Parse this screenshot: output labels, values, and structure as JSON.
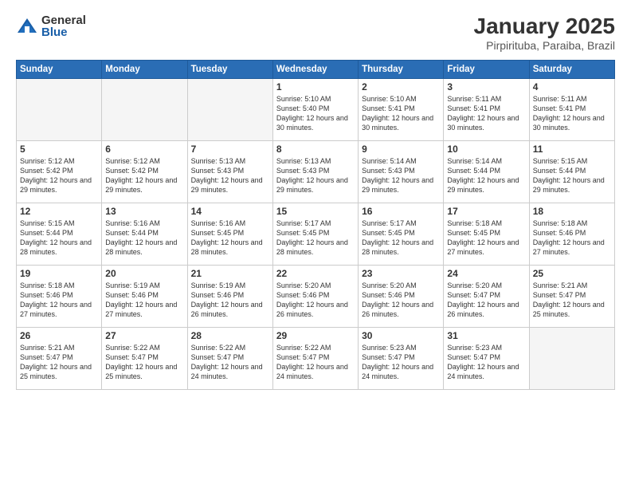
{
  "logo": {
    "general": "General",
    "blue": "Blue"
  },
  "title": "January 2025",
  "subtitle": "Pirpirituba, Paraiba, Brazil",
  "weekdays": [
    "Sunday",
    "Monday",
    "Tuesday",
    "Wednesday",
    "Thursday",
    "Friday",
    "Saturday"
  ],
  "weeks": [
    [
      {
        "day": "",
        "info": ""
      },
      {
        "day": "",
        "info": ""
      },
      {
        "day": "",
        "info": ""
      },
      {
        "day": "1",
        "info": "Sunrise: 5:10 AM\nSunset: 5:40 PM\nDaylight: 12 hours\nand 30 minutes."
      },
      {
        "day": "2",
        "info": "Sunrise: 5:10 AM\nSunset: 5:41 PM\nDaylight: 12 hours\nand 30 minutes."
      },
      {
        "day": "3",
        "info": "Sunrise: 5:11 AM\nSunset: 5:41 PM\nDaylight: 12 hours\nand 30 minutes."
      },
      {
        "day": "4",
        "info": "Sunrise: 5:11 AM\nSunset: 5:41 PM\nDaylight: 12 hours\nand 30 minutes."
      }
    ],
    [
      {
        "day": "5",
        "info": "Sunrise: 5:12 AM\nSunset: 5:42 PM\nDaylight: 12 hours\nand 29 minutes."
      },
      {
        "day": "6",
        "info": "Sunrise: 5:12 AM\nSunset: 5:42 PM\nDaylight: 12 hours\nand 29 minutes."
      },
      {
        "day": "7",
        "info": "Sunrise: 5:13 AM\nSunset: 5:43 PM\nDaylight: 12 hours\nand 29 minutes."
      },
      {
        "day": "8",
        "info": "Sunrise: 5:13 AM\nSunset: 5:43 PM\nDaylight: 12 hours\nand 29 minutes."
      },
      {
        "day": "9",
        "info": "Sunrise: 5:14 AM\nSunset: 5:43 PM\nDaylight: 12 hours\nand 29 minutes."
      },
      {
        "day": "10",
        "info": "Sunrise: 5:14 AM\nSunset: 5:44 PM\nDaylight: 12 hours\nand 29 minutes."
      },
      {
        "day": "11",
        "info": "Sunrise: 5:15 AM\nSunset: 5:44 PM\nDaylight: 12 hours\nand 29 minutes."
      }
    ],
    [
      {
        "day": "12",
        "info": "Sunrise: 5:15 AM\nSunset: 5:44 PM\nDaylight: 12 hours\nand 28 minutes."
      },
      {
        "day": "13",
        "info": "Sunrise: 5:16 AM\nSunset: 5:44 PM\nDaylight: 12 hours\nand 28 minutes."
      },
      {
        "day": "14",
        "info": "Sunrise: 5:16 AM\nSunset: 5:45 PM\nDaylight: 12 hours\nand 28 minutes."
      },
      {
        "day": "15",
        "info": "Sunrise: 5:17 AM\nSunset: 5:45 PM\nDaylight: 12 hours\nand 28 minutes."
      },
      {
        "day": "16",
        "info": "Sunrise: 5:17 AM\nSunset: 5:45 PM\nDaylight: 12 hours\nand 28 minutes."
      },
      {
        "day": "17",
        "info": "Sunrise: 5:18 AM\nSunset: 5:45 PM\nDaylight: 12 hours\nand 27 minutes."
      },
      {
        "day": "18",
        "info": "Sunrise: 5:18 AM\nSunset: 5:46 PM\nDaylight: 12 hours\nand 27 minutes."
      }
    ],
    [
      {
        "day": "19",
        "info": "Sunrise: 5:18 AM\nSunset: 5:46 PM\nDaylight: 12 hours\nand 27 minutes."
      },
      {
        "day": "20",
        "info": "Sunrise: 5:19 AM\nSunset: 5:46 PM\nDaylight: 12 hours\nand 27 minutes."
      },
      {
        "day": "21",
        "info": "Sunrise: 5:19 AM\nSunset: 5:46 PM\nDaylight: 12 hours\nand 26 minutes."
      },
      {
        "day": "22",
        "info": "Sunrise: 5:20 AM\nSunset: 5:46 PM\nDaylight: 12 hours\nand 26 minutes."
      },
      {
        "day": "23",
        "info": "Sunrise: 5:20 AM\nSunset: 5:46 PM\nDaylight: 12 hours\nand 26 minutes."
      },
      {
        "day": "24",
        "info": "Sunrise: 5:20 AM\nSunset: 5:47 PM\nDaylight: 12 hours\nand 26 minutes."
      },
      {
        "day": "25",
        "info": "Sunrise: 5:21 AM\nSunset: 5:47 PM\nDaylight: 12 hours\nand 25 minutes."
      }
    ],
    [
      {
        "day": "26",
        "info": "Sunrise: 5:21 AM\nSunset: 5:47 PM\nDaylight: 12 hours\nand 25 minutes."
      },
      {
        "day": "27",
        "info": "Sunrise: 5:22 AM\nSunset: 5:47 PM\nDaylight: 12 hours\nand 25 minutes."
      },
      {
        "day": "28",
        "info": "Sunrise: 5:22 AM\nSunset: 5:47 PM\nDaylight: 12 hours\nand 24 minutes."
      },
      {
        "day": "29",
        "info": "Sunrise: 5:22 AM\nSunset: 5:47 PM\nDaylight: 12 hours\nand 24 minutes."
      },
      {
        "day": "30",
        "info": "Sunrise: 5:23 AM\nSunset: 5:47 PM\nDaylight: 12 hours\nand 24 minutes."
      },
      {
        "day": "31",
        "info": "Sunrise: 5:23 AM\nSunset: 5:47 PM\nDaylight: 12 hours\nand 24 minutes."
      },
      {
        "day": "",
        "info": ""
      }
    ]
  ]
}
